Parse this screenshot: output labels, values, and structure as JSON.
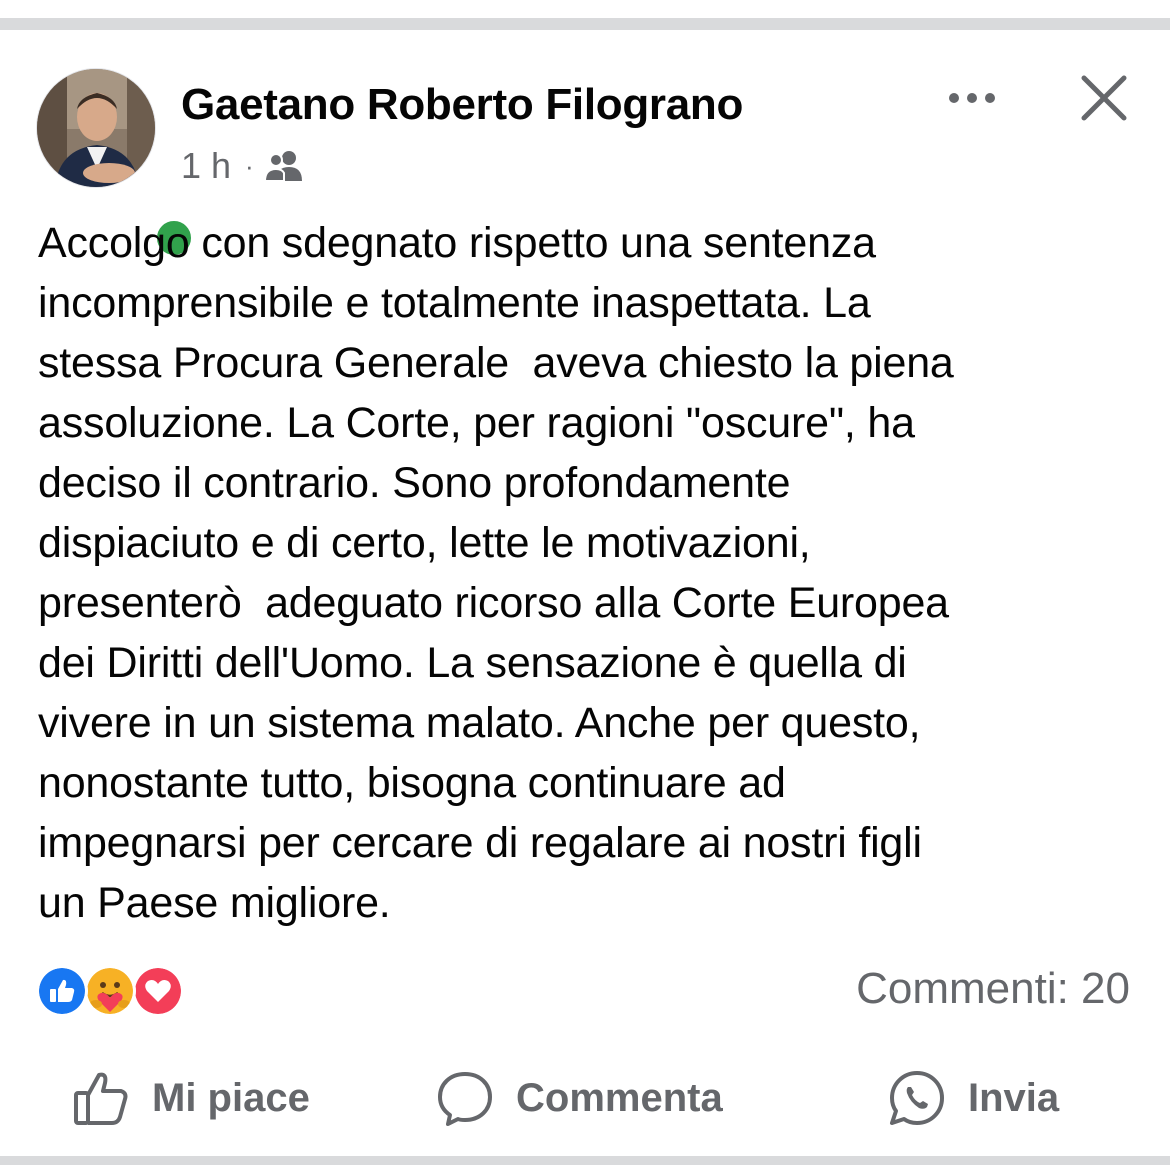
{
  "post": {
    "author_name": "Gaetano Roberto Filograno",
    "timestamp": "1 h",
    "separator": "·",
    "audience_icon": "friends-icon",
    "online": true,
    "body": "Accolgo con sdegnato rispetto una sentenza\nincomprensibile e totalmente inaspettata. La\nstessa Procura Generale  aveva chiesto la piena\nassoluzione. La Corte, per ragioni \"oscure\", ha\ndeciso il contrario. Sono profondamente\ndispiaciuto e di certo, lette le motivazioni,\npresenterò  adeguato ricorso alla Corte Europea\ndei Diritti dell'Uomo. La sensazione è quella di\nvivere in un sistema malato. Anche per questo,\nnonostante tutto, bisogna continuare ad\nimpegnarsi per cercare di regalare ai nostri figli\nun Paese migliore."
  },
  "reactions": {
    "icons": [
      "like-icon",
      "care-icon",
      "love-icon"
    ],
    "comments_label": "Commenti: 20"
  },
  "actions": {
    "like_label": "Mi piace",
    "comment_label": "Commenta",
    "share_label": "Invia"
  },
  "colors": {
    "secondary_text": "#65676b",
    "online_green": "#31a24c",
    "like_blue": "#1877f2",
    "love_red": "#f33e58",
    "care_yellow": "#f7b125",
    "divider": "#d9dadc"
  }
}
